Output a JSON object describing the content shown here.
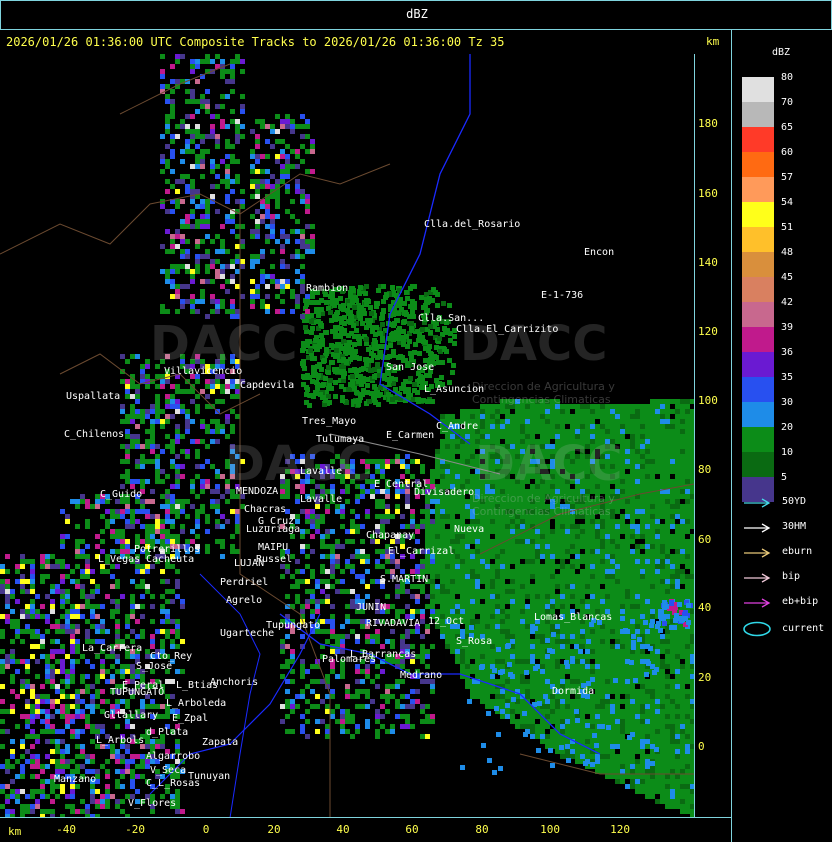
{
  "title": "dBZ",
  "header": "2026/01/26 01:36:00 UTC Composite Tracks to 2026/01/26 01:36:00 Tz 35",
  "km_label": "km",
  "y_axis": {
    "ticks": [
      "180",
      "160",
      "140",
      "120",
      "100",
      "80",
      "60",
      "40",
      "20",
      "0"
    ]
  },
  "x_axis": {
    "ticks": [
      "-40",
      "-20",
      "0",
      "20",
      "40",
      "60",
      "80",
      "100",
      "120"
    ]
  },
  "legend": {
    "title": "dBZ",
    "levels": [
      {
        "label": "80",
        "color": "#e0e0e0"
      },
      {
        "label": "70",
        "color": "#b8b8b8"
      },
      {
        "label": "65",
        "color": "#ff3a28"
      },
      {
        "label": "60",
        "color": "#ff6a12"
      },
      {
        "label": "57",
        "color": "#ff9a5a"
      },
      {
        "label": "54",
        "color": "#ffff1a"
      },
      {
        "label": "51",
        "color": "#ffc02a"
      },
      {
        "label": "48",
        "color": "#d98f3c"
      },
      {
        "label": "45",
        "color": "#d98060"
      },
      {
        "label": "42",
        "color": "#c8688e"
      },
      {
        "label": "39",
        "color": "#c01a8c"
      },
      {
        "label": "36",
        "color": "#6a1ad2"
      },
      {
        "label": "35",
        "color": "#2850f0"
      },
      {
        "label": "30",
        "color": "#1e8ce8"
      },
      {
        "label": "20",
        "color": "#0c8c18"
      },
      {
        "label": "10",
        "color": "#0a6a12"
      },
      {
        "label": "5",
        "color": "#46368c"
      }
    ],
    "tracks": [
      {
        "label": "50YD",
        "color": "#48d8e8"
      },
      {
        "label": "30HM",
        "color": "#ffffff"
      },
      {
        "label": "eburn",
        "color": "#e8c878"
      },
      {
        "label": "bip",
        "color": "#f0c8d8"
      },
      {
        "label": "eb+bip",
        "color": "#e040e0"
      }
    ],
    "current_label": "current",
    "current_color": "#30d8e8"
  },
  "places": [
    "Clla.del_Rosario",
    "Encon",
    "Rambion",
    "Clla.San...",
    "Clla.El_Carrizito",
    "E-1-736",
    "San Jose",
    "L_Asuncion",
    "Villavicencio",
    "Capdevila",
    "Uspallata",
    "Tres_Mayo",
    "C_Andre",
    "Tulumaya",
    "E_Carmen",
    "C_Chilenos",
    "Lavalle",
    "E_Central",
    "Divisadero",
    "C_Guido",
    "Cacheuta",
    "Potrerillos",
    "L_Vegas",
    "MENDOZA",
    "Luzuriaga",
    "MAIPU",
    "Russel",
    "LUJAN",
    "Perdriel",
    "Agrelo",
    "Ugarteche",
    "L_Barrancas",
    "La_Carrera",
    "Cto_Rey",
    "S_Jose",
    "E_Peral",
    "TUPUNGATO",
    "L_Btias",
    "Anchoris",
    "L_Arboleda",
    "Gltallary",
    "E_Zpal",
    "d_Plata",
    "L_Arbols",
    "Zapata",
    "Algarrobo",
    "V_Seca",
    "Tunuyan",
    "C_L_Rosas",
    "V_Flores",
    "Lomas_Blancas",
    "Dormida",
    "S_Rosa",
    "12_Oct",
    "Chapanay",
    "S.MARTIN",
    "JUNIN",
    "RIVADAVIA",
    "Tupungato",
    "El_Carrizal",
    "Medrano",
    "Nueva",
    "Lavalle",
    "Chacras",
    "G_Cruz",
    "Manzano",
    "Palomares"
  ],
  "watermark": {
    "name": "DACC",
    "subtitle": "Direccion de Agricultura y Contingencias Climaticas"
  }
}
